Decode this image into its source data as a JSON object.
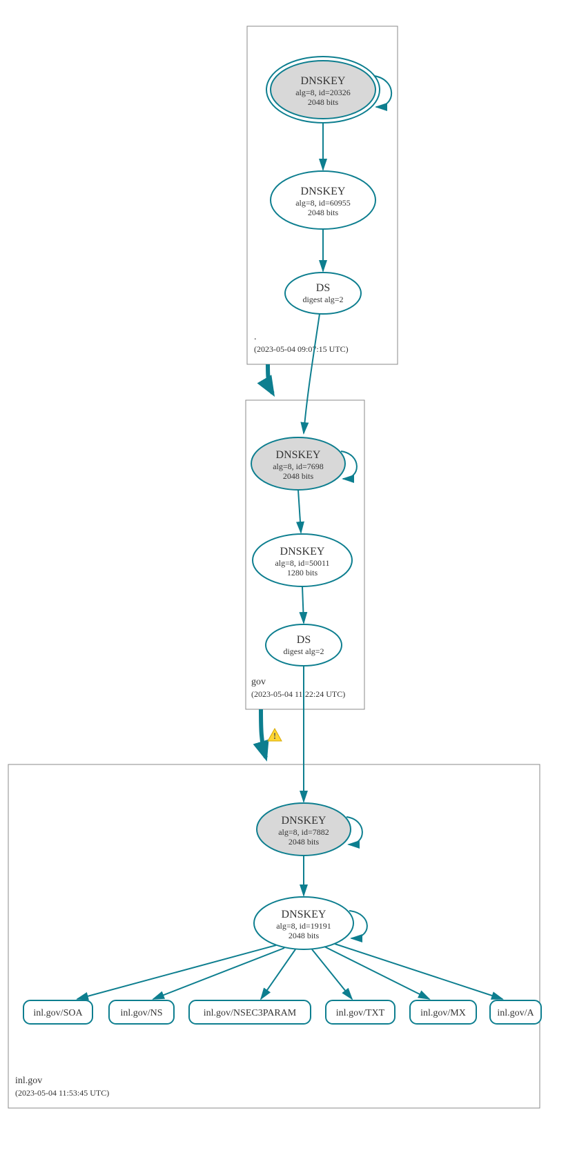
{
  "zones": {
    "root": {
      "name": ".",
      "timestamp": "(2023-05-04 09:07:15 UTC)",
      "dnskey_ksk": {
        "title": "DNSKEY",
        "alg_id": "alg=8, id=20326",
        "bits": "2048 bits"
      },
      "dnskey_zsk": {
        "title": "DNSKEY",
        "alg_id": "alg=8, id=60955",
        "bits": "2048 bits"
      },
      "ds": {
        "title": "DS",
        "digest": "digest alg=2"
      }
    },
    "gov": {
      "name": "gov",
      "timestamp": "(2023-05-04 11:22:24 UTC)",
      "dnskey_ksk": {
        "title": "DNSKEY",
        "alg_id": "alg=8, id=7698",
        "bits": "2048 bits"
      },
      "dnskey_zsk": {
        "title": "DNSKEY",
        "alg_id": "alg=8, id=50011",
        "bits": "1280 bits"
      },
      "ds": {
        "title": "DS",
        "digest": "digest alg=2"
      }
    },
    "inlgov": {
      "name": "inl.gov",
      "timestamp": "(2023-05-04 11:53:45 UTC)",
      "dnskey_ksk": {
        "title": "DNSKEY",
        "alg_id": "alg=8, id=7882",
        "bits": "2048 bits"
      },
      "dnskey_zsk": {
        "title": "DNSKEY",
        "alg_id": "alg=8, id=19191",
        "bits": "2048 bits"
      },
      "records": {
        "soa": "inl.gov/SOA",
        "ns": "inl.gov/NS",
        "nsec3param": "inl.gov/NSEC3PARAM",
        "txt": "inl.gov/TXT",
        "mx": "inl.gov/MX",
        "a": "inl.gov/A"
      }
    }
  }
}
